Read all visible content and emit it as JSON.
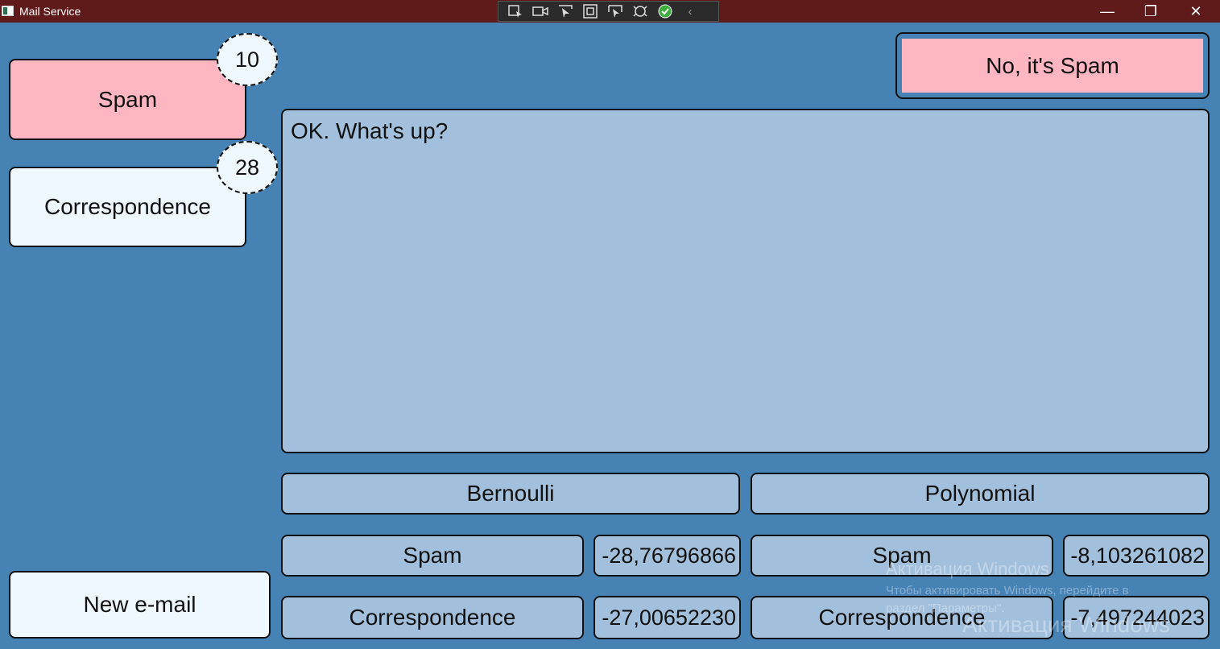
{
  "window": {
    "title": "Mail Service",
    "controls": {
      "minimize": "—",
      "maximize": "❐",
      "close": "✕"
    }
  },
  "sidebar": {
    "folders": [
      {
        "label": "Spam",
        "count": "10",
        "color": "#ffb6c1"
      },
      {
        "label": "Correspondence",
        "count": "28",
        "color": "#f0f8ff"
      }
    ],
    "new_email_label": "New e-mail"
  },
  "main": {
    "reply_label": "No, it's Spam",
    "message": "OK. What's up?"
  },
  "classifiers": {
    "bernoulli": {
      "label": "Bernoulli",
      "results": [
        {
          "class": "Spam",
          "score": "-28,76796866"
        },
        {
          "class": "Correspondence",
          "score": "-27,00652230"
        }
      ]
    },
    "polynomial": {
      "label": "Polynomial",
      "results": [
        {
          "class": "Spam",
          "score": "-8,103261082"
        },
        {
          "class": "Correspondence",
          "score": "-7,497244023"
        }
      ]
    }
  },
  "watermark": {
    "title": "Активация Windows",
    "line1": "Чтобы активировать Windows, перейдите в",
    "line2": "раздел \"Параметры\".",
    "title2": "Активация Windows"
  },
  "colors": {
    "background": "#4682b4",
    "titlebar": "#5f1a1a",
    "spam_accent": "#ffb6c1",
    "pale": "#f0f8ff",
    "panel_blue": "#a2c0dc"
  },
  "toolbar_icons": [
    "select-element-icon",
    "record-icon",
    "pointer-icon",
    "frame-icon",
    "layout-icon",
    "hot-reload-icon",
    "check-icon",
    "collapse-arrow-icon"
  ]
}
